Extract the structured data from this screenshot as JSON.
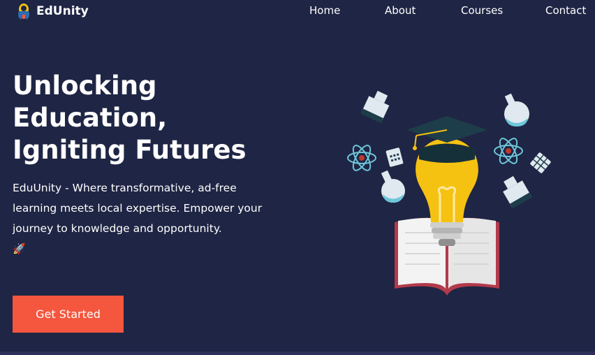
{
  "brand": {
    "name": "EdUnity",
    "logo_icon": "rocket-bulb-icon"
  },
  "nav": {
    "items": [
      {
        "label": "Home"
      },
      {
        "label": "About"
      },
      {
        "label": "Courses"
      },
      {
        "label": "Contact"
      }
    ]
  },
  "hero": {
    "title_lines": [
      "Unlocking",
      "Education,",
      "Igniting Futures"
    ],
    "description": "EduUnity - Where transformative, ad-free learning meets local expertise. Empower your journey to knowledge and opportunity.",
    "emoji": "🚀",
    "cta_label": "Get Started",
    "illustration": "lightbulb-graduation-cap-book-science-icons"
  },
  "colors": {
    "background": "#1f2544",
    "accent": "#f5563e",
    "bulb": "#f5c211",
    "cap": "#1e3d4a",
    "book": "#b33a4c",
    "science": "#6fc6d9"
  }
}
